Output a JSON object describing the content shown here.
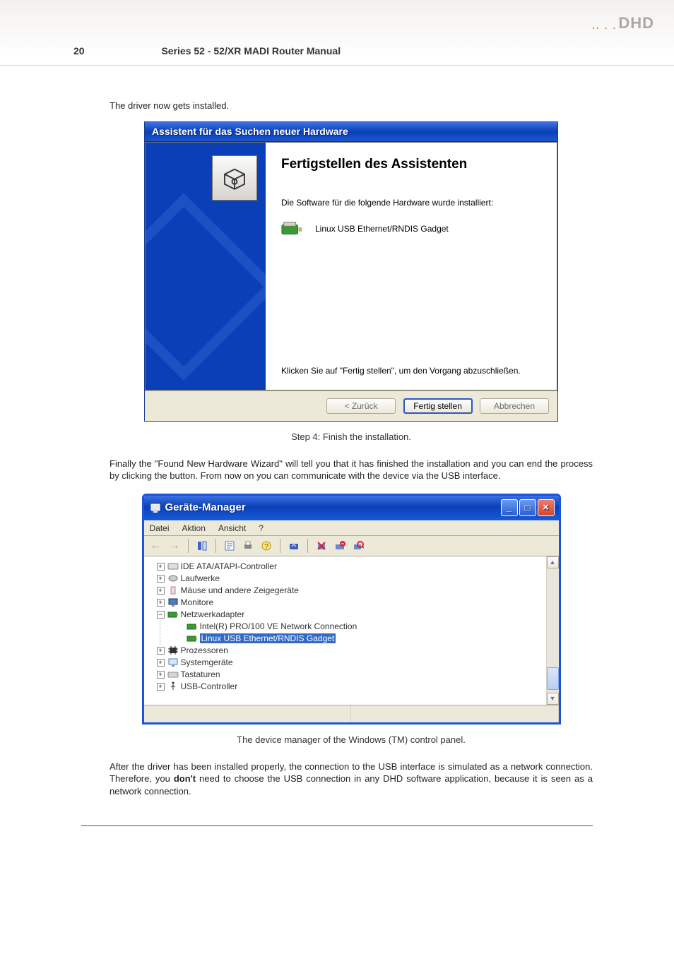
{
  "logo": {
    "text": "DHD"
  },
  "header": {
    "page_number": "20",
    "title": "Series 52 - 52/XR MADI Router Manual"
  },
  "paragraph_intro": "The driver now gets installed.",
  "wizard": {
    "titlebar": "Assistent für das Suchen neuer Hardware",
    "heading": "Fertigstellen des Assistenten",
    "subtext": "Die Software für die folgende Hardware wurde installiert:",
    "device_name": "Linux USB Ethernet/RNDIS Gadget",
    "click_text": "Klicken Sie auf \"Fertig stellen\", um den Vorgang abzuschließen.",
    "buttons": {
      "back": "< Zurück",
      "finish": "Fertig stellen",
      "cancel": "Abbrechen"
    }
  },
  "caption1": "Step 4: Finish the installation.",
  "paragraph_mid_a": "Finally the \"Found New Hardware Wizard\" will tell you that it has finished the installation and you can end the process by clicking the ",
  "paragraph_mid_b": " button. From now on you can communicate with the device via the USB interface.",
  "device_manager": {
    "title": "Geräte-Manager",
    "menus": [
      "Datei",
      "Aktion",
      "Ansicht",
      "?"
    ],
    "tree": {
      "ide": "IDE ATA/ATAPI-Controller",
      "laufwerke": "Laufwerke",
      "maus": "Mäuse und andere Zeigegeräte",
      "monitore": "Monitore",
      "netzwerk": "Netzwerkadapter",
      "intel": "Intel(R) PRO/100 VE Network Connection",
      "rndis": "Linux USB Ethernet/RNDIS Gadget",
      "prozessoren": "Prozessoren",
      "systemgeraete": "Systemgeräte",
      "tastaturen": "Tastaturen",
      "usb": "USB-Controller"
    }
  },
  "caption2": "The device manager of the Windows (TM) control panel.",
  "paragraph_end_a": "After the driver has been installed properly, the connection to the USB interface is simulated as a network connection. Therefore, you ",
  "paragraph_end_bold": "don't",
  "paragraph_end_b": " need to choose the USB connection in any DHD software application, because it is seen as a network connection."
}
